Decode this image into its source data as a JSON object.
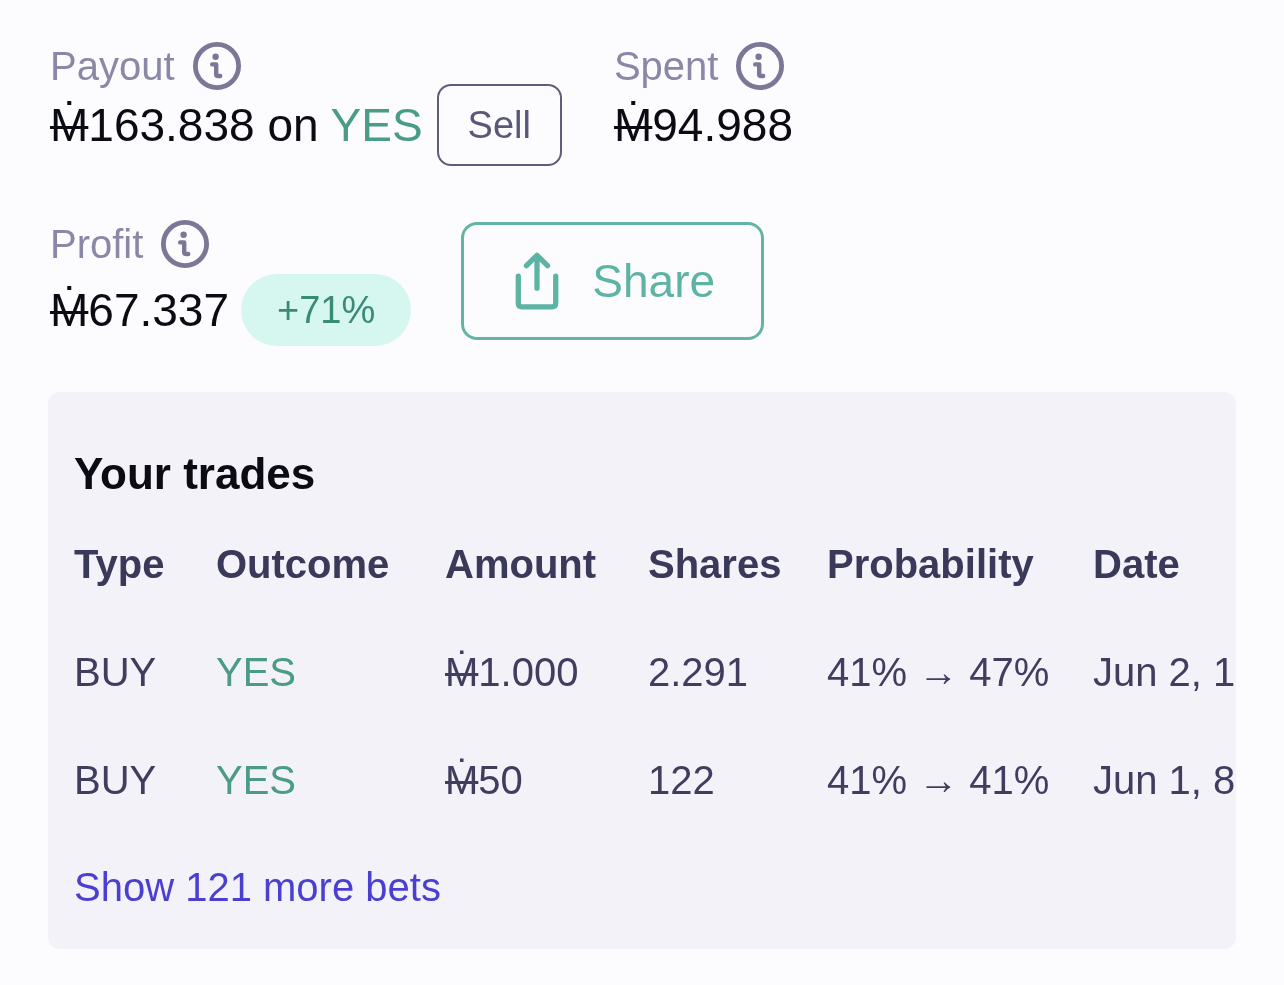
{
  "stats": [
    {
      "label": "Payout",
      "amount": "Ṁ163.838",
      "connector": "on",
      "outcome": "YES",
      "action": "Sell"
    },
    {
      "label": "Spent",
      "amount": "Ṁ94.988"
    }
  ],
  "profit": {
    "label": "Profit",
    "amount": "Ṁ67.337",
    "change": "+71%"
  },
  "share_button": {
    "label": "Share"
  },
  "trades": {
    "title": "Your trades",
    "columns": [
      "Type",
      "Outcome",
      "Amount",
      "Shares",
      "Probability",
      "Date"
    ],
    "rows": [
      {
        "type": "BUY",
        "outcome": "YES",
        "amount": "Ṁ1.000",
        "shares": "2.291",
        "probability": "41% → 47%",
        "date": "Jun 2, 1"
      },
      {
        "type": "BUY",
        "outcome": "YES",
        "amount": "Ṁ50",
        "shares": "122",
        "probability": "41% → 41%",
        "date": "Jun 1, 8"
      }
    ],
    "more_link": "Show 121 more bets"
  }
}
